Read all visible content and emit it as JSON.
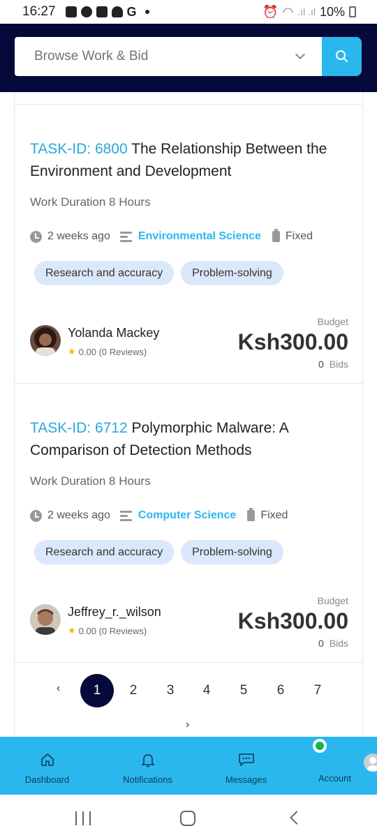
{
  "status_bar": {
    "time": "16:27",
    "battery": "10%"
  },
  "search": {
    "placeholder": "Browse Work & Bid"
  },
  "tasks": [
    {
      "task_id": "TASK-ID: 6800",
      "title": "The Relationship Between the Environment and Development",
      "duration": "Work Duration 8 Hours",
      "posted": "2 weeks ago",
      "category": "Environmental Science",
      "price_type": "Fixed",
      "tags": [
        "Research and accuracy",
        "Problem-solving"
      ],
      "client": "Yolanda Mackey",
      "rating": "0.00 (0 Reviews)",
      "budget_label": "Budget",
      "budget": "Ksh300.00",
      "bids_count": "0",
      "bids_label": "Bids"
    },
    {
      "task_id": "TASK-ID: 6712",
      "title": "Polymorphic Malware: A Comparison of Detection Methods",
      "duration": "Work Duration 8 Hours",
      "posted": "2 weeks ago",
      "category": "Computer Science",
      "price_type": "Fixed",
      "tags": [
        "Research and accuracy",
        "Problem-solving"
      ],
      "client": "Jeffrey_r._wilson",
      "rating": "0.00 (0 Reviews)",
      "budget_label": "Budget",
      "budget": "Ksh300.00",
      "bids_count": "0",
      "bids_label": "Bids"
    }
  ],
  "pagination": {
    "prev": "‹",
    "next": "›",
    "pages": [
      "1",
      "2",
      "3",
      "4",
      "5",
      "6",
      "7"
    ],
    "current": "1"
  },
  "bottom_nav": {
    "dashboard": "Dashboard",
    "notifications": "Notifications",
    "messages": "Messages",
    "account": "Account"
  },
  "colors": {
    "header_bg": "#050a3a",
    "accent": "#2ab7ee",
    "tag_bg": "#dbe8fb",
    "online": "#19b34a"
  }
}
